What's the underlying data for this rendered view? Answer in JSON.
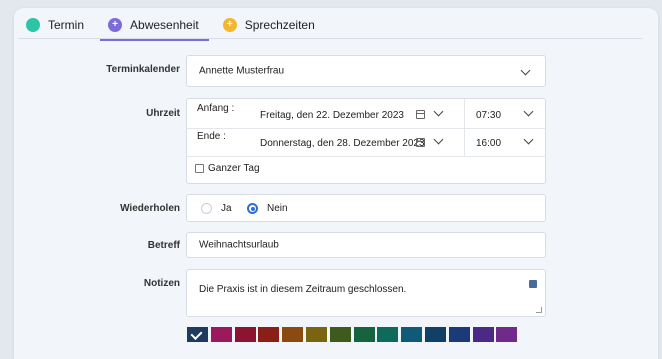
{
  "tabs": [
    {
      "label": "Termin",
      "color": "#2ec4a6",
      "icon": "circle-dot-icon",
      "active": false
    },
    {
      "label": "Abwesenheit",
      "color": "#7c6bd8",
      "icon": "plus-icon",
      "active": true
    },
    {
      "label": "Sprechzeiten",
      "color": "#f2b631",
      "icon": "plus-icon",
      "active": false
    }
  ],
  "form": {
    "terminkalender": {
      "label": "Terminkalender",
      "value": "Annette Musterfrau"
    },
    "uhrzeit": {
      "label": "Uhrzeit",
      "anfang_label": "Anfang :",
      "anfang_date": "Freitag, den 22. Dezember 2023",
      "anfang_time": "07:30",
      "ende_label": "Ende :",
      "ende_date": "Donnerstag, den 28. Dezember 2023",
      "ende_time": "16:00",
      "ganzer_tag": "Ganzer Tag"
    },
    "wiederholen": {
      "label": "Wiederholen",
      "ja": "Ja",
      "nein": "Nein",
      "selected": "Nein"
    },
    "betreff": {
      "label": "Betreff",
      "value": "Weihnachtsurlaub"
    },
    "notizen": {
      "label": "Notizen",
      "value": "Die Praxis ist in diesem Zeitraum geschlossen."
    }
  },
  "colors": [
    "#1f3a5f",
    "#9c1a5b",
    "#8c1430",
    "#8a1f18",
    "#8a4a12",
    "#7a6410",
    "#3e5a1e",
    "#16633f",
    "#0f6a5e",
    "#0f5a78",
    "#123f66",
    "#1a3a78",
    "#4a2a86",
    "#6f2a8a"
  ],
  "selected_color": "#1f3a5f"
}
